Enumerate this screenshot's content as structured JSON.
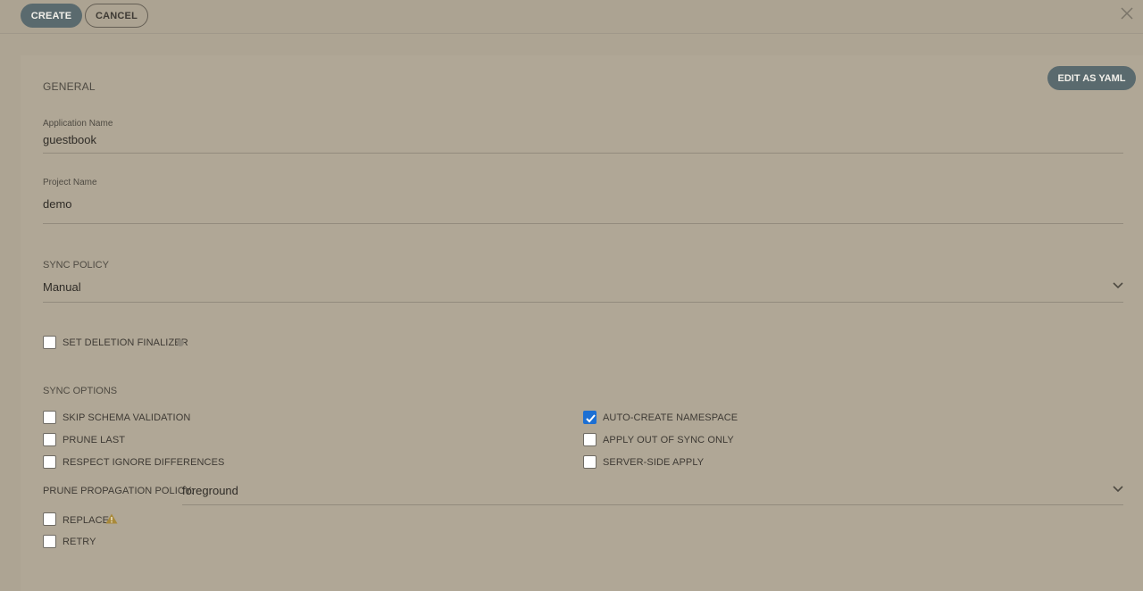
{
  "toolbar": {
    "create_label": "CREATE",
    "cancel_label": "CANCEL",
    "close_icon": "close-icon"
  },
  "general": {
    "title": "GENERAL",
    "edit_yaml_label": "EDIT AS YAML",
    "application_name": {
      "label": "Application Name",
      "value": "guestbook"
    },
    "project_name": {
      "label": "Project Name",
      "value": "demo"
    }
  },
  "sync_policy": {
    "label": "SYNC POLICY",
    "value": "Manual"
  },
  "finalizer": {
    "label": "SET DELETION FINALIZER",
    "checked": false
  },
  "sync_options": {
    "title": "SYNC OPTIONS",
    "skip_schema_validation": {
      "label": "SKIP SCHEMA VALIDATION",
      "checked": false
    },
    "prune_last": {
      "label": "PRUNE LAST",
      "checked": false
    },
    "respect_ignore_differences": {
      "label": "RESPECT IGNORE DIFFERENCES",
      "checked": false
    },
    "auto_create_namespace": {
      "label": "AUTO-CREATE NAMESPACE",
      "checked": true
    },
    "apply_out_of_sync_only": {
      "label": "APPLY OUT OF SYNC ONLY",
      "checked": false
    },
    "server_side_apply": {
      "label": "SERVER-SIDE APPLY",
      "checked": false
    },
    "prune_propagation_policy": {
      "label": "PRUNE PROPAGATION POLICY:",
      "value": "foreground"
    },
    "replace": {
      "label": "REPLACE",
      "checked": false
    },
    "retry": {
      "label": "RETRY",
      "checked": false
    }
  },
  "colors": {
    "primary_button": "#5a6a6e",
    "checkbox_checked": "#1c6fd3",
    "warning": "#a8893a"
  }
}
